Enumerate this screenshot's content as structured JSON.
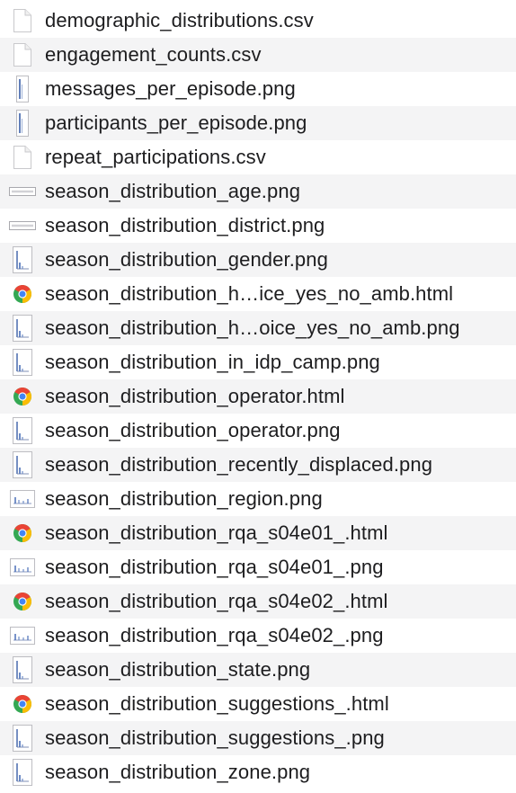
{
  "files": [
    {
      "name": "demographic_distributions.csv",
      "icon": "csv-document-icon"
    },
    {
      "name": "engagement_counts.csv",
      "icon": "csv-document-icon"
    },
    {
      "name": "messages_per_episode.png",
      "icon": "tall-chart-thumbnail-icon"
    },
    {
      "name": "participants_per_episode.png",
      "icon": "tall-chart-thumbnail-icon"
    },
    {
      "name": "repeat_participations.csv",
      "icon": "csv-document-icon"
    },
    {
      "name": "season_distribution_age.png",
      "icon": "wide-chart-thumbnail-icon"
    },
    {
      "name": "season_distribution_district.png",
      "icon": "wide-chart-thumbnail-icon"
    },
    {
      "name": "season_distribution_gender.png",
      "icon": "chart-thumbnail-icon"
    },
    {
      "name": "season_distribution_h…ice_yes_no_amb.html",
      "icon": "chrome-html-icon"
    },
    {
      "name": "season_distribution_h…oice_yes_no_amb.png",
      "icon": "chart-thumbnail-icon"
    },
    {
      "name": "season_distribution_in_idp_camp.png",
      "icon": "chart-thumbnail-icon"
    },
    {
      "name": "season_distribution_operator.html",
      "icon": "chrome-html-icon"
    },
    {
      "name": "season_distribution_operator.png",
      "icon": "chart-thumbnail-icon"
    },
    {
      "name": "season_distribution_recently_displaced.png",
      "icon": "chart-thumbnail-icon"
    },
    {
      "name": "season_distribution_region.png",
      "icon": "landscape-chart-thumbnail-icon"
    },
    {
      "name": "season_distribution_rqa_s04e01_.html",
      "icon": "chrome-html-icon"
    },
    {
      "name": "season_distribution_rqa_s04e01_.png",
      "icon": "landscape-chart-thumbnail-icon"
    },
    {
      "name": "season_distribution_rqa_s04e02_.html",
      "icon": "chrome-html-icon"
    },
    {
      "name": "season_distribution_rqa_s04e02_.png",
      "icon": "landscape-chart-thumbnail-icon"
    },
    {
      "name": "season_distribution_state.png",
      "icon": "chart-thumbnail-icon"
    },
    {
      "name": "season_distribution_suggestions_.html",
      "icon": "chrome-html-icon"
    },
    {
      "name": "season_distribution_suggestions_.png",
      "icon": "chart-thumbnail-icon"
    },
    {
      "name": "season_distribution_zone.png",
      "icon": "chart-thumbnail-icon"
    }
  ]
}
